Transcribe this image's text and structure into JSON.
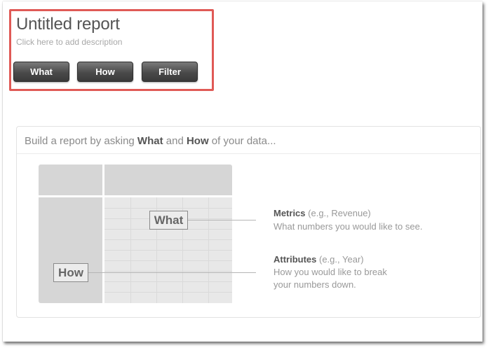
{
  "report": {
    "title": "Untitled report",
    "description_placeholder": "Click here to add description"
  },
  "toolbar": {
    "what_label": "What",
    "how_label": "How",
    "filter_label": "Filter"
  },
  "panel": {
    "heading_prefix": "Build a report by asking ",
    "heading_what": "What",
    "heading_and": " and ",
    "heading_how": "How",
    "heading_suffix": " of your data..."
  },
  "diagram": {
    "what_tag": "What",
    "how_tag": "How"
  },
  "legend": {
    "metrics_title": "Metrics",
    "metrics_example": " (e.g., Revenue)",
    "metrics_desc": "What numbers you would like to see.",
    "attributes_title": "Attributes",
    "attributes_example": " (e.g., Year)",
    "attributes_desc_line1": "How you would like to break",
    "attributes_desc_line2": "your numbers down."
  },
  "colors": {
    "highlight_border": "#e05a56",
    "button_bg": "#4a4a4a"
  }
}
